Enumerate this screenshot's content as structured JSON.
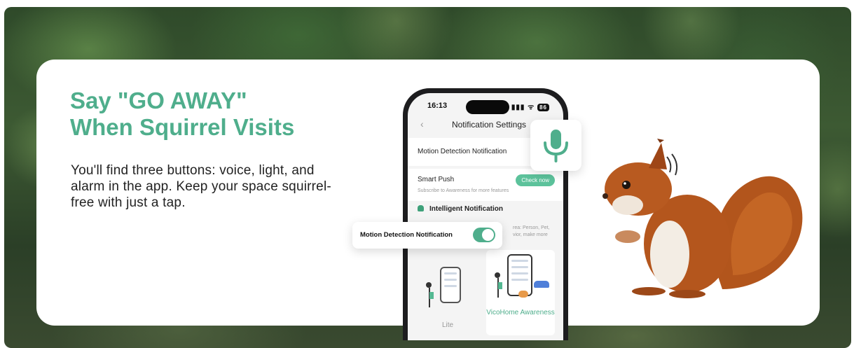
{
  "headline": {
    "line1": "Say \"GO AWAY\"",
    "line2": "When Squirrel Visits"
  },
  "body": "You'll find three buttons: voice, light, and alarm in the app. Keep your space squirrel-free with just a tap.",
  "phone": {
    "status_time": "16:13",
    "status_icons": "▮▮▮ ᯤ",
    "battery": "86",
    "back": "‹",
    "nav_title": "Notification Settings",
    "row1_label": "Motion Detection Notification",
    "row2_label": "Smart Push",
    "row2_sub": "Subscribe to Awareness for more features",
    "check_button": "Check now",
    "section_title": "Intelligent Notification",
    "section_desc": "rea: Person, Pet, vior, make more",
    "plans": [
      {
        "label": "Lite"
      },
      {
        "label": "VicoHome Awareness"
      }
    ]
  },
  "toggle_card": {
    "label": "Motion Detection Notification",
    "state": "on"
  },
  "icons": {
    "mic": "microphone-icon",
    "bell": "bell-icon",
    "toggle": "toggle-switch-icon"
  },
  "colors": {
    "accent": "#4fae8c",
    "text_dark": "#222222"
  }
}
